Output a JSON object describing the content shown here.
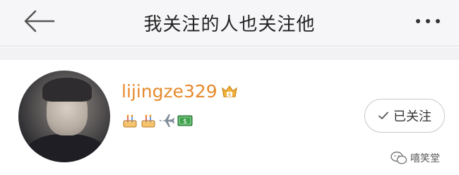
{
  "header": {
    "title": "我关注的人也关注他",
    "back_icon": "arrow-left-icon",
    "more_icon": "more-horizontal-icon"
  },
  "user": {
    "username": "lijingze329",
    "vip_icon": "crown-vip-icon",
    "badges": [
      "cake-icon",
      "cake-icon",
      "airplane-icon",
      "money-icon"
    ],
    "follow_state_label": "已关注",
    "follow_icon": "checkmark-icon"
  },
  "watermark": {
    "icon": "wechat-icon",
    "text": "嘻笑堂"
  },
  "colors": {
    "username": "#e68a2e",
    "header_bg": "#f6f6f8",
    "button_border": "#c8c8c8"
  }
}
